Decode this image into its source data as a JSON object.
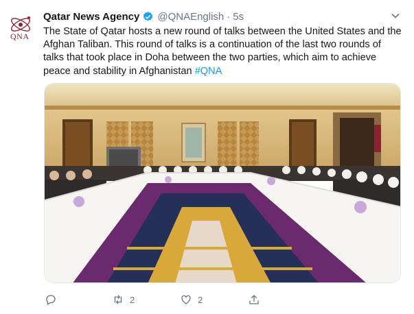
{
  "tweet": {
    "author_name": "Qatar News Agency",
    "handle": "@QNAEnglish",
    "separator": "·",
    "time": "5s",
    "avatar_text": "QNA",
    "text": "The State of Qatar hosts a new round of talks between the United States and the Afghan Taliban. This round of talks is a continuation of the last two rounds of talks that took place in Doha between the two parties, which aim to achieve peace and stability in Afghanistan ",
    "hashtag": "#QNA",
    "actions": {
      "reply_icon": "reply-icon",
      "retweet_icon": "retweet-icon",
      "retweet_count": "2",
      "like_icon": "heart-icon",
      "like_count": "2",
      "share_icon": "share-icon"
    }
  },
  "colors": {
    "link": "#1b95e0",
    "text": "#14171a",
    "muted": "#657786",
    "verified": "#1da1f2",
    "brand": "#8b2332"
  }
}
